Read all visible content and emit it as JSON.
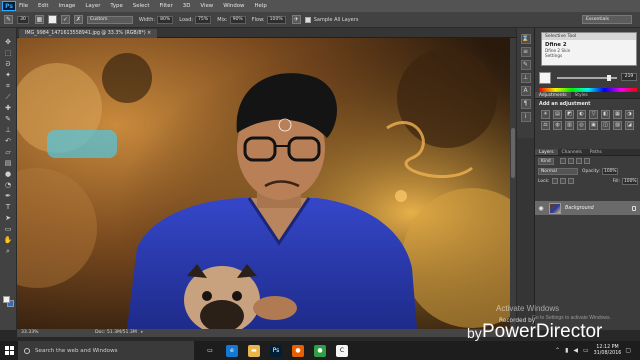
{
  "app": {
    "logo": "Ps"
  },
  "menu": [
    "File",
    "Edit",
    "Image",
    "Layer",
    "Type",
    "Select",
    "Filter",
    "3D",
    "View",
    "Window",
    "Help"
  ],
  "options": {
    "size_value": "30",
    "style_dropdown": "Custom",
    "width_label": "Width:",
    "width_value": "80%",
    "load_label": "Load:",
    "load_value": "75%",
    "mix_label": "Mix:",
    "mix_value": "90%",
    "flow_label": "Flow:",
    "flow_value": "100%",
    "sample_label": "Sample All Layers",
    "workspace": "Essentials"
  },
  "document": {
    "tab_label": "IMG_9984_1471613558941.jpg @ 33.3% (RGB/8*) ×"
  },
  "status": {
    "zoom": "33.33%",
    "doc": "Doc: 51.3M/51.3M",
    "arrow": "▸"
  },
  "selective_tool": {
    "title": "Selective Tool",
    "heading": "Dfine 2",
    "row": "Dfine 2     Skin",
    "settings": "Settings"
  },
  "color": {
    "value": "219",
    "slider_fraction": 0.86
  },
  "adjustments": {
    "tabs": [
      "Adjustments",
      "Styles"
    ],
    "add_label": "Add an adjustment",
    "icons": [
      "☀",
      "▤",
      "◩",
      "◐",
      "▽",
      "◧",
      "▦",
      "◑",
      "⚖",
      "◍",
      "▥",
      "◎",
      "▣",
      "◫",
      "▨",
      "◪"
    ]
  },
  "layers": {
    "tabs": [
      "Layers",
      "Channels",
      "Paths"
    ],
    "kind_label": "Kind",
    "blend_mode": "Normal",
    "opacity_label": "Opacity:",
    "opacity_value": "100%",
    "lock_label": "Lock:",
    "fill_label": "Fill:",
    "fill_value": "100%",
    "background_layer": "Background"
  },
  "watermark": {
    "small": "Recorded by",
    "by": "by",
    "brand": "PowerDirector",
    "activate": "Activate Windows",
    "activate_sub": "Go to Settings to activate Windows."
  },
  "taskbar": {
    "search_placeholder": "Search the web and Windows",
    "apps": [
      {
        "name": "task-view",
        "glyph": "▭",
        "color": "#1d1d1d"
      },
      {
        "name": "edge",
        "glyph": "e",
        "color": "#1479d4"
      },
      {
        "name": "file-explorer",
        "glyph": "▬",
        "color": "#e8b64a"
      },
      {
        "name": "photoshop",
        "glyph": "Ps",
        "color": "#001e36"
      },
      {
        "name": "firefox",
        "glyph": "●",
        "color": "#e66000"
      },
      {
        "name": "chrome",
        "glyph": "●",
        "color": "#2f9e44"
      },
      {
        "name": "powerdirector",
        "glyph": "C",
        "color": "#f5f5f5"
      }
    ],
    "time": "12:12 PM",
    "date": "31/08/2016"
  }
}
